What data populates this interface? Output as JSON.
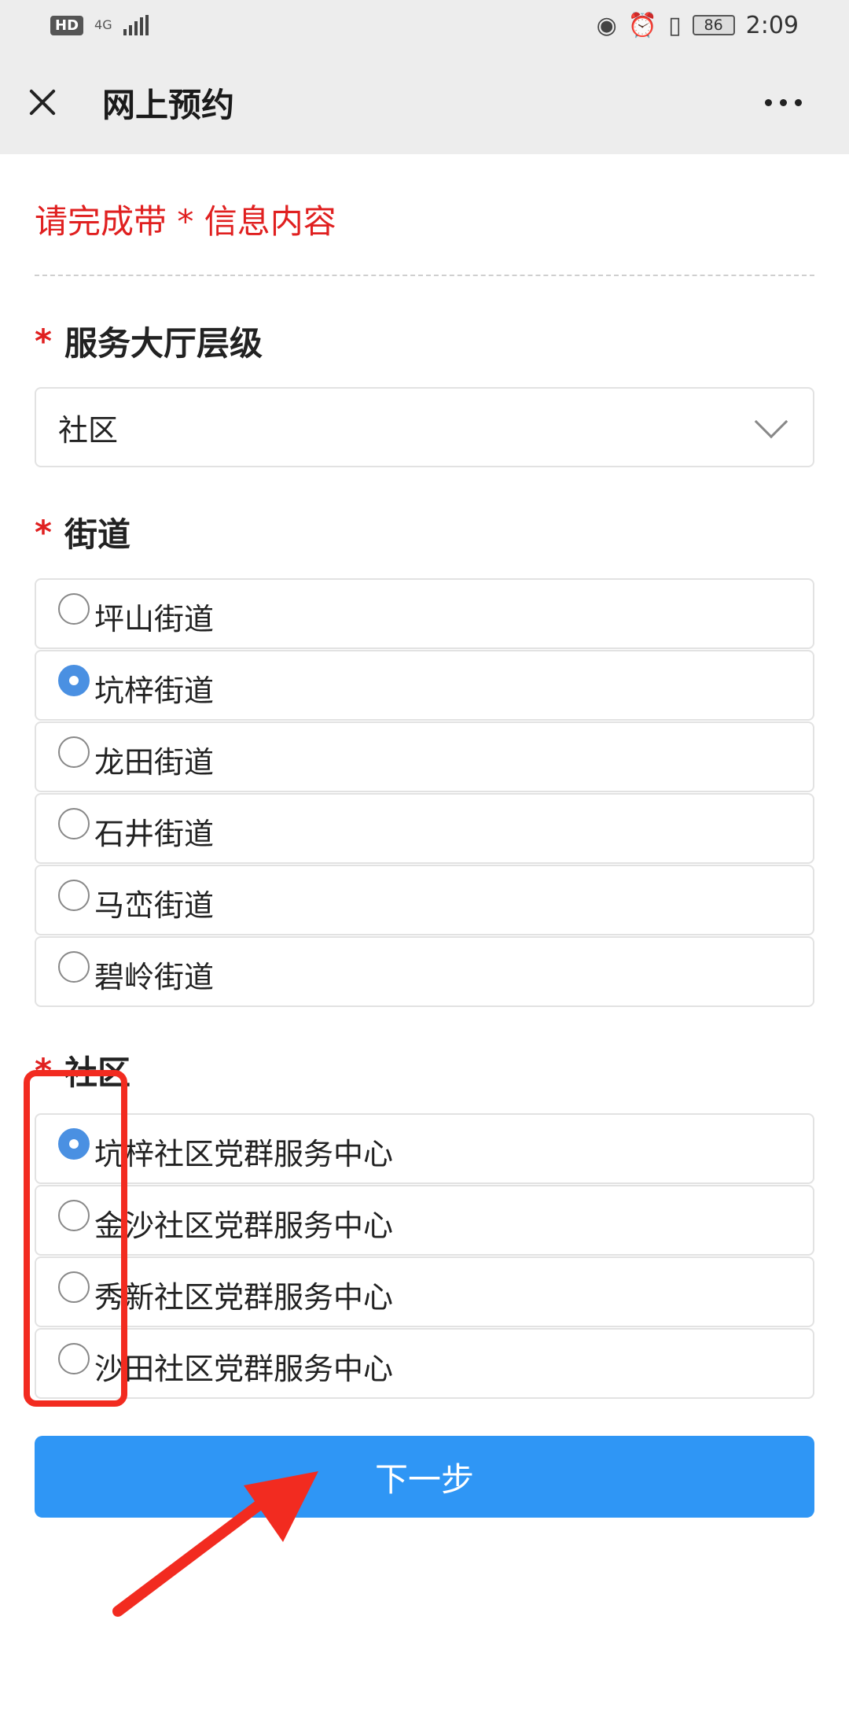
{
  "status_bar": {
    "hd": "HD",
    "network": "4G",
    "battery": "86",
    "time": "2:09"
  },
  "navbar": {
    "title": "网上预约"
  },
  "form": {
    "notice": "请完成带 * 信息内容",
    "required_mark": "*",
    "hall_level": {
      "label": "服务大厅层级",
      "selected": "社区"
    },
    "street": {
      "label": "街道",
      "options": [
        "坪山街道",
        "坑梓街道",
        "龙田街道",
        "石井街道",
        "马峦街道",
        "碧岭街道"
      ],
      "selected_index": 1
    },
    "community": {
      "label": "社区",
      "options": [
        "坑梓社区党群服务中心",
        "金沙社区党群服务中心",
        "秀新社区党群服务中心",
        "沙田社区党群服务中心"
      ],
      "selected_index": 0
    },
    "next_label": "下一步"
  },
  "colors": {
    "accent": "#2f96f5",
    "required": "#e02020",
    "annotation": "#f22b20"
  }
}
